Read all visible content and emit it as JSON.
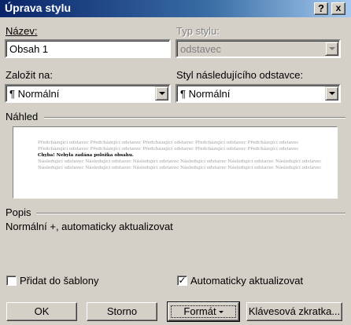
{
  "window": {
    "title": "Úprava stylu",
    "help_btn": "?",
    "close_btn": "x"
  },
  "name": {
    "label": "Název:",
    "value": "Obsah 1"
  },
  "style_type": {
    "label": "Typ stylu:",
    "value": "odstavec"
  },
  "based_on": {
    "label": "Založit na:",
    "value": "¶ Normální"
  },
  "next_style": {
    "label": "Styl následujícího odstavce:",
    "value": "¶ Normální"
  },
  "preview": {
    "label": "Náhled",
    "prev_text": "Předcházející odstavec Předcházející odstavec Předcházející odstavec Předcházející odstavec Předcházející odstavec Předcházející odstavec Předcházející odstavec Předcházející odstavec Předcházející odstavec Předcházející odstavec",
    "current_text": "Chyba! Nebyla zadána položka obsahu.",
    "next_text": "Následující odstavec Následující odstavec Následující odstavec Následující odstavec Následující odstavec Následující odstavec Následující odstavec Následující odstavec Následující odstavec Následující odstavec Následující odstavec Následující odstavec"
  },
  "description": {
    "label": "Popis",
    "text": "Normální +, automaticky aktualizovat"
  },
  "add_to_template": {
    "label": "Přidat do šablony",
    "checked": false
  },
  "auto_update": {
    "label": "Automaticky aktualizovat",
    "checked": true,
    "mark": "✓"
  },
  "buttons": {
    "ok": "OK",
    "cancel": "Storno",
    "format": "Formát",
    "shortcut": "Klávesová zkratka..."
  }
}
